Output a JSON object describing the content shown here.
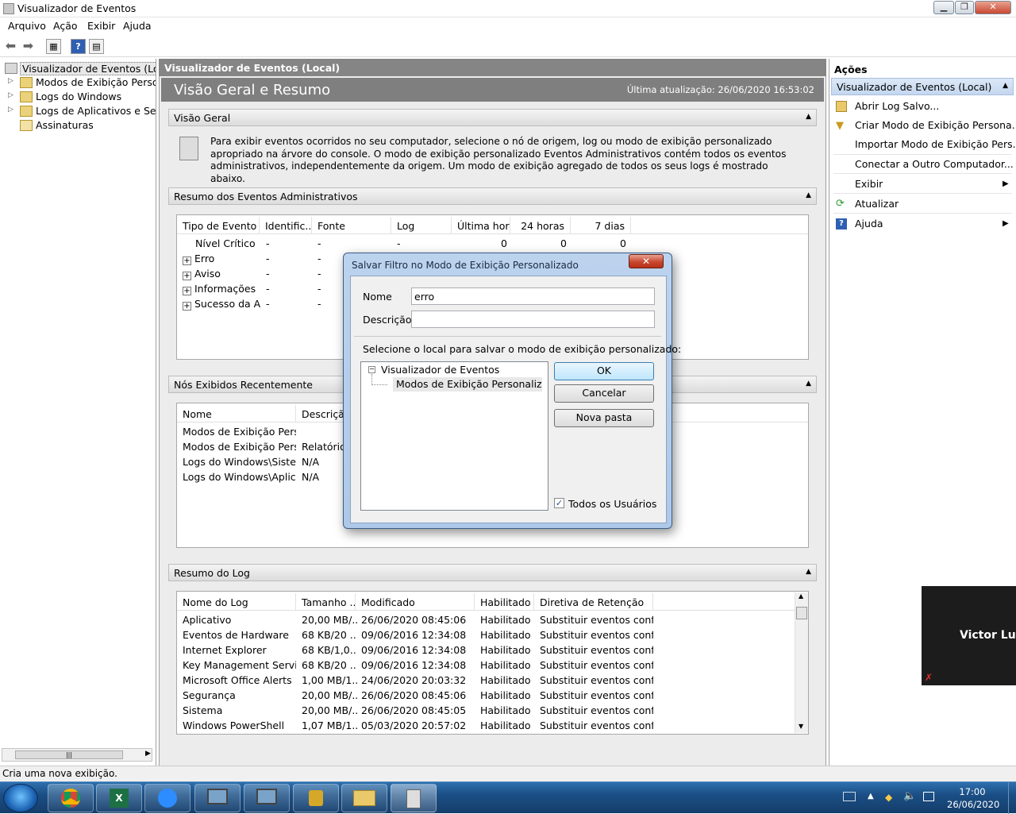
{
  "window": {
    "title": "Visualizador de Eventos"
  },
  "menu": [
    "Arquivo",
    "Ação",
    "Exibir",
    "Ajuda"
  ],
  "tree": [
    {
      "label": "Visualizador de Eventos (Local)"
    },
    {
      "label": "Modos de Exibição Personalizados"
    },
    {
      "label": "Logs do Windows"
    },
    {
      "label": "Logs de Aplicativos e Serviços"
    },
    {
      "label": "Assinaturas"
    }
  ],
  "center": {
    "header": "Visualizador de Eventos (Local)",
    "banner_title": "Visão Geral e Resumo",
    "last_update": "Última atualização: 26/06/2020 16:53:02",
    "overview": {
      "title": "Visão Geral",
      "text": "Para exibir eventos ocorridos no seu computador, selecione o nó de origem, log ou modo de exibição personalizado apropriado na árvore do console. O modo de exibição personalizado Eventos Administrativos contém todos os eventos administrativos, independentemente da origem. Um modo de exibição agregado de todos os seus logs é mostrado abaixo."
    },
    "admin_summary": {
      "title": "Resumo dos Eventos Administrativos",
      "columns": [
        "Tipo de Evento",
        "Identific...",
        "Fonte",
        "Log",
        "Última hora",
        "24 horas",
        "7 dias"
      ],
      "rows": [
        {
          "type": "Nível Crítico",
          "id": "-",
          "source": "-",
          "log": "-",
          "hour": "0",
          "day": "0",
          "week": "0"
        },
        {
          "type": "Erro",
          "id": "-",
          "source": "-"
        },
        {
          "type": "Aviso",
          "id": "-",
          "source": "-"
        },
        {
          "type": "Informações",
          "id": "-",
          "source": "-"
        },
        {
          "type": "Sucesso da A...",
          "id": "-",
          "source": "-"
        }
      ]
    },
    "recent": {
      "title": "Nós Exibidos Recentemente",
      "columns": [
        "Nome",
        "Descrição"
      ],
      "rows": [
        {
          "name": "Modos de Exibição Perso...",
          "desc": ""
        },
        {
          "name": "Modos de Exibição Perso...",
          "desc": "Relatório..."
        },
        {
          "name": "Logs do Windows\\Sistema",
          "desc": "N/A"
        },
        {
          "name": "Logs do Windows\\Aplica...",
          "desc": "N/A"
        }
      ]
    },
    "log_summary": {
      "title": "Resumo do Log",
      "columns": [
        "Nome do Log",
        "Tamanho ...",
        "Modificado",
        "Habilitado",
        "Diretiva de Retenção"
      ],
      "rows": [
        {
          "name": "Aplicativo",
          "size": "20,00 MB/...",
          "mod": "26/06/2020 08:45:06",
          "en": "Habilitado",
          "ret": "Substituir eventos confo..."
        },
        {
          "name": "Eventos de Hardware",
          "size": "68 KB/20 ...",
          "mod": "09/06/2016 12:34:08",
          "en": "Habilitado",
          "ret": "Substituir eventos confo..."
        },
        {
          "name": "Internet Explorer",
          "size": "68 KB/1,0...",
          "mod": "09/06/2016 12:34:08",
          "en": "Habilitado",
          "ret": "Substituir eventos confo..."
        },
        {
          "name": "Key Management Service",
          "size": "68 KB/20 ...",
          "mod": "09/06/2016 12:34:08",
          "en": "Habilitado",
          "ret": "Substituir eventos confo..."
        },
        {
          "name": "Microsoft Office Alerts",
          "size": "1,00 MB/1...",
          "mod": "24/06/2020 20:03:32",
          "en": "Habilitado",
          "ret": "Substituir eventos confo..."
        },
        {
          "name": "Segurança",
          "size": "20,00 MB/...",
          "mod": "26/06/2020 08:45:06",
          "en": "Habilitado",
          "ret": "Substituir eventos confo..."
        },
        {
          "name": "Sistema",
          "size": "20,00 MB/...",
          "mod": "26/06/2020 08:45:05",
          "en": "Habilitado",
          "ret": "Substituir eventos confo..."
        },
        {
          "name": "Windows PowerShell",
          "size": "1,07 MB/1...",
          "mod": "05/03/2020 20:57:02",
          "en": "Habilitado",
          "ret": "Substituir eventos confo..."
        }
      ]
    }
  },
  "actions": {
    "title": "Ações",
    "group": "Visualizador de Eventos (Local)",
    "items": [
      "Abrir Log Salvo...",
      "Criar Modo de Exibição Persona...",
      "Importar Modo de Exibição Pers...",
      "Conectar a Outro Computador...",
      "Exibir",
      "Atualizar",
      "Ajuda"
    ]
  },
  "dialog": {
    "title": "Salvar Filtro no Modo de Exibição Personalizado",
    "name_label": "Nome",
    "name_value": "erro",
    "desc_label": "Descrição",
    "desc_value": "",
    "location_label": "Selecione o local para salvar o modo de exibição personalizado:",
    "tree_root": "Visualizador de Eventos",
    "tree_child": "Modos de Exibição Personalizados",
    "ok": "OK",
    "cancel": "Cancelar",
    "new_folder": "Nova pasta",
    "all_users": "Todos os Usuários",
    "all_users_checked": true
  },
  "status": "Cria uma nova exibição.",
  "video": {
    "name": "Victor Luiz"
  },
  "clock": {
    "time": "17:00",
    "date": "26/06/2020"
  },
  "colors": {
    "accent": "#c4d7ef",
    "header": "#858585",
    "taskbar": "#1b4f85"
  }
}
